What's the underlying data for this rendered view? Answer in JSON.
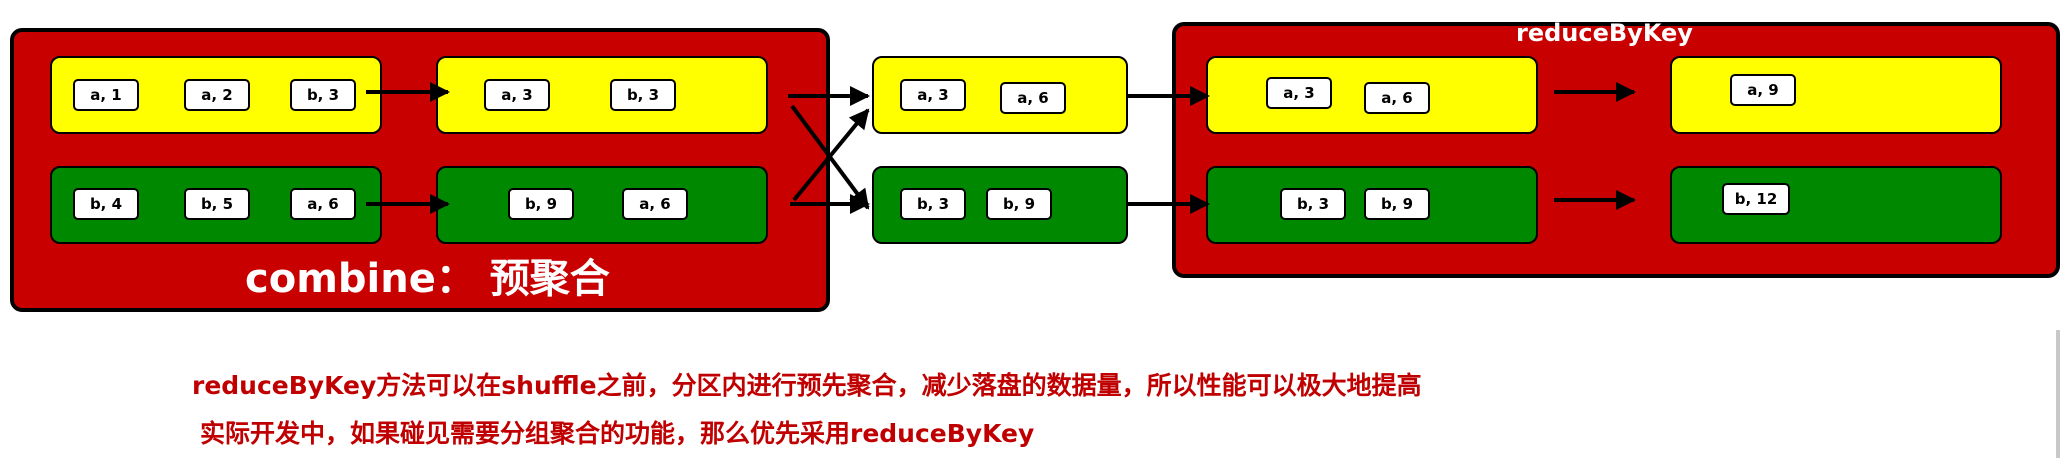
{
  "combine_panel": {
    "title": "combine： 预聚合",
    "partitions": [
      {
        "color": "yellow",
        "items": [
          "a, 1",
          "a, 2",
          "b, 3"
        ]
      },
      {
        "color": "green",
        "items": [
          "b, 4",
          "b, 5",
          "a, 6"
        ]
      }
    ],
    "results": [
      {
        "color": "yellow",
        "items": [
          "a, 3",
          "b, 3"
        ]
      },
      {
        "color": "green",
        "items": [
          "b, 9",
          "a, 6"
        ]
      }
    ]
  },
  "shuffle": [
    {
      "color": "yellow",
      "items": [
        "a, 3",
        "a, 6"
      ]
    },
    {
      "color": "green",
      "items": [
        "b, 3",
        "b, 9"
      ]
    }
  ],
  "reduce_panel": {
    "title": "reduceByKey",
    "inputs": [
      {
        "color": "yellow",
        "items": [
          "a, 3",
          "a, 6"
        ]
      },
      {
        "color": "green",
        "items": [
          "b, 3",
          "b, 9"
        ]
      }
    ],
    "outputs": [
      {
        "color": "yellow",
        "items": [
          "a, 9"
        ]
      },
      {
        "color": "green",
        "items": [
          "b, 12"
        ]
      }
    ]
  },
  "notes": {
    "line1": "reduceByKey方法可以在shuffle之前，分区内进行预先聚合，减少落盘的数据量，所以性能可以极大地提高",
    "line2": "实际开发中，如果碰见需要分组聚合的功能，那么优先采用reduceByKey"
  },
  "colors": {
    "panel": "#c80000",
    "yellow": "#ffff00",
    "green": "#008800",
    "note": "#c00000"
  }
}
